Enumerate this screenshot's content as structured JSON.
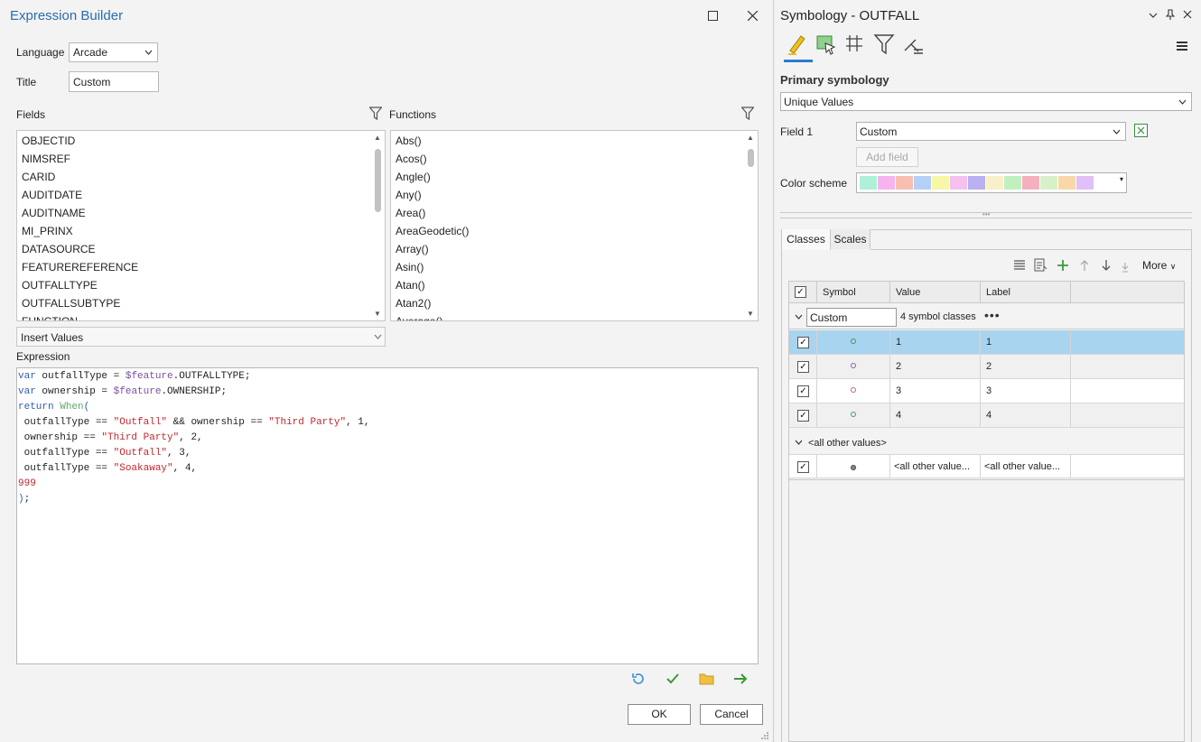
{
  "dialog": {
    "title": "Expression Builder",
    "language_label": "Language",
    "language_value": "Arcade",
    "title_label": "Title",
    "title_value": "Custom",
    "fields_label": "Fields",
    "functions_label": "Functions",
    "fields": [
      "OBJECTID",
      "NIMSREF",
      "CARID",
      "AUDITDATE",
      "AUDITNAME",
      "MI_PRINX",
      "DATASOURCE",
      "FEATUREREFERENCE",
      "OUTFALLTYPE",
      "OUTFALLSUBTYPE",
      "FUNCTION"
    ],
    "functions": [
      "Abs()",
      "Acos()",
      "Angle()",
      "Any()",
      "Area()",
      "AreaGeodetic()",
      "Array()",
      "Asin()",
      "Atan()",
      "Atan2()",
      "Average()"
    ],
    "insert_values": "Insert Values",
    "expression_label": "Expression",
    "ok_label": "OK",
    "cancel_label": "Cancel"
  },
  "pane": {
    "title": "Symbology - OUTFALL",
    "primary_label": "Primary symbology",
    "renderer": "Unique Values",
    "field1_label": "Field 1",
    "field1_value": "Custom",
    "add_field": "Add field",
    "color_scheme_label": "Color scheme",
    "color_scheme_colors": [
      "#aef0d8",
      "#f7b3f0",
      "#f8bfb0",
      "#b5d0f7",
      "#f7f7a8",
      "#f5c0f0",
      "#b8b0f0",
      "#f8f0c8",
      "#c0f0c0",
      "#f5b0c0",
      "#d8f0c8",
      "#f8d8a8",
      "#e0c0f8"
    ],
    "tab_classes": "Classes",
    "tab_scales": "Scales",
    "more_label": "More",
    "col_symbol": "Symbol",
    "col_value": "Value",
    "col_label": "Label",
    "group_name": "Custom",
    "group_count": "4 symbol classes",
    "rows": [
      {
        "value": "1",
        "label": "1",
        "color": "#3a9a5a"
      },
      {
        "value": "2",
        "label": "2",
        "color": "#8a5ab0"
      },
      {
        "value": "3",
        "label": "3",
        "color": "#b06a8a"
      },
      {
        "value": "4",
        "label": "4",
        "color": "#3a9a7a"
      }
    ],
    "other_header": "<all other values>",
    "other_value": "<all other value...",
    "other_label": "<all other value..."
  }
}
